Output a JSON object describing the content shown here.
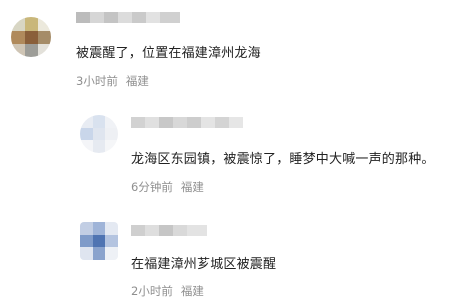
{
  "comments": [
    {
      "text": "被震醒了，位置在福建漳州龙海",
      "time": "3小时前",
      "location": "福建"
    },
    {
      "text": "龙海区东园镇，被震惊了，睡梦中大喊一声的那种。",
      "time": "6分钟前",
      "location": "福建"
    },
    {
      "text": "在福建漳州芗城区被震醒",
      "time": "2小时前",
      "location": "福建"
    }
  ]
}
